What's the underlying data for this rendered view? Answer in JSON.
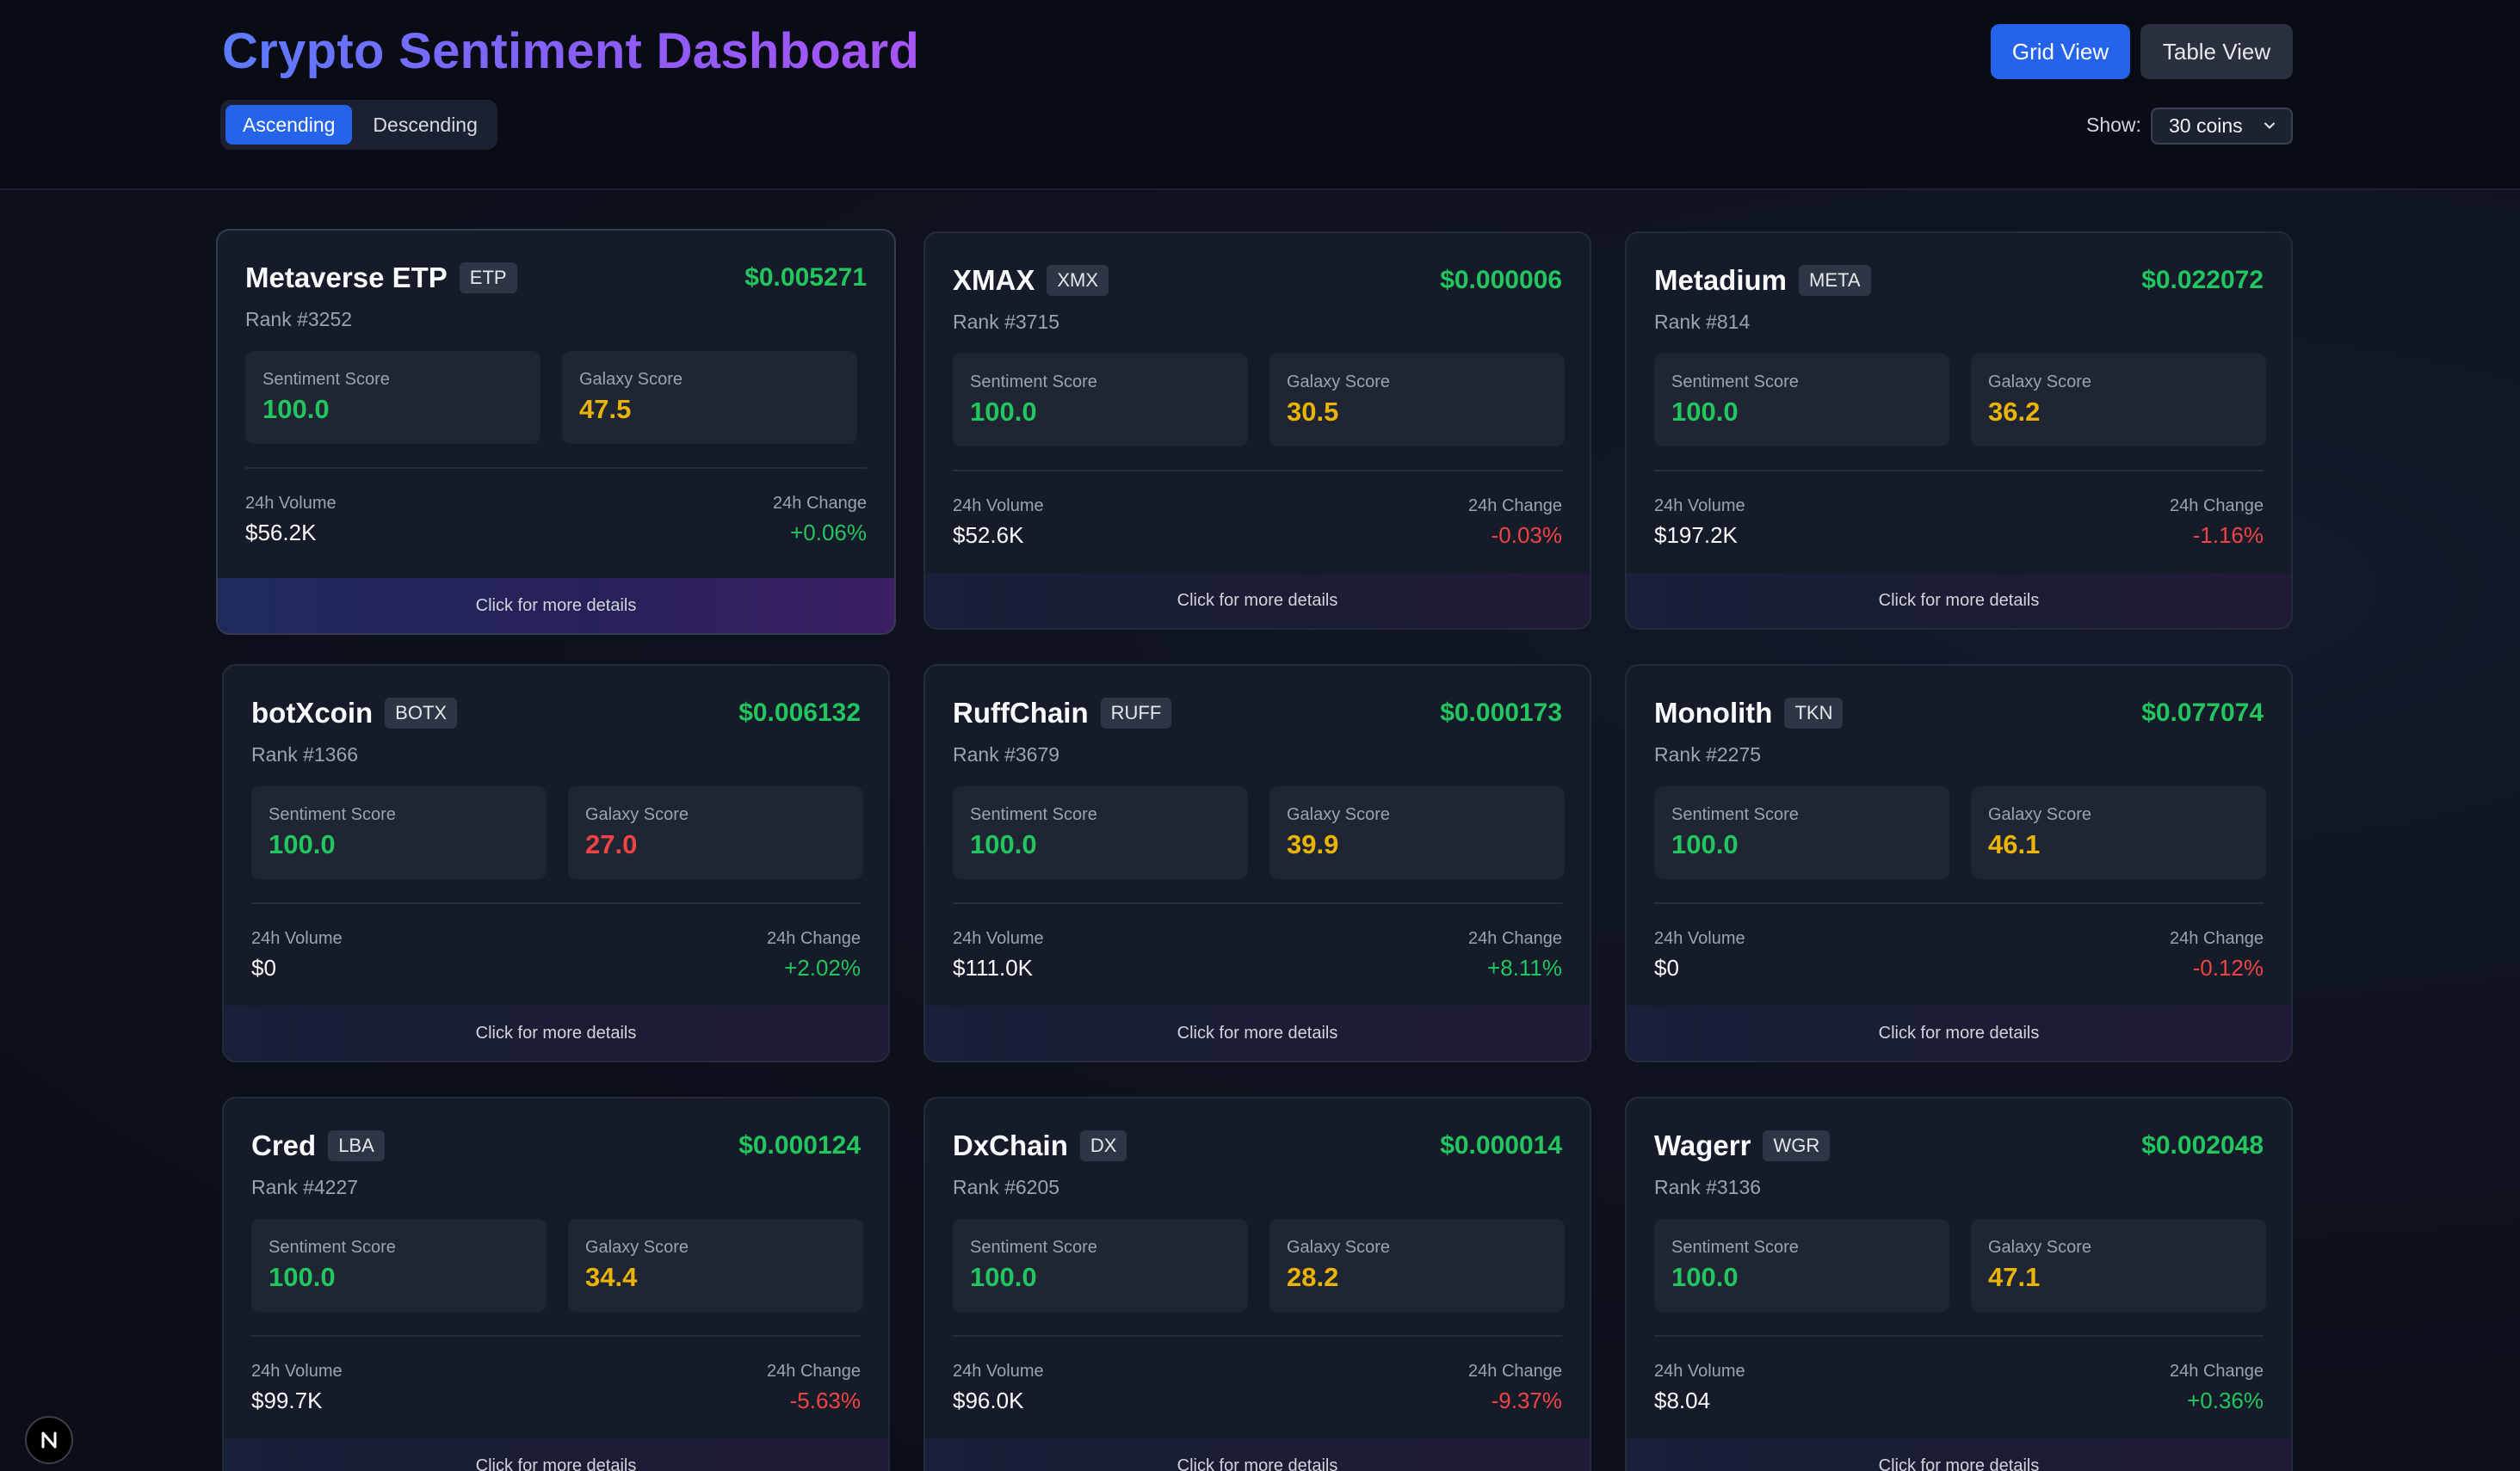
{
  "header": {
    "title": "Crypto Sentiment Dashboard",
    "sort": {
      "ascending": "Ascending",
      "descending": "Descending"
    },
    "views": {
      "grid": "Grid View",
      "table": "Table View"
    },
    "show_label": "Show:",
    "show_value": "30 coins"
  },
  "labels": {
    "sentiment": "Sentiment Score",
    "galaxy": "Galaxy Score",
    "volume": "24h Volume",
    "change": "24h Change",
    "details": "Click for more details"
  },
  "colors": {
    "accent": "#2563eb",
    "positive": "#22c55e",
    "negative": "#ef4444",
    "medium": "#eab308"
  },
  "coins": [
    {
      "name": "Metaverse ETP",
      "symbol": "ETP",
      "price": "$0.005271",
      "rank": "Rank #3252",
      "sentiment": "100.0",
      "galaxy": "47.5",
      "volume": "$56.2K",
      "change": "+0.06%"
    },
    {
      "name": "XMAX",
      "symbol": "XMX",
      "price": "$0.000006",
      "rank": "Rank #3715",
      "sentiment": "100.0",
      "galaxy": "30.5",
      "volume": "$52.6K",
      "change": "-0.03%"
    },
    {
      "name": "Metadium",
      "symbol": "META",
      "price": "$0.022072",
      "rank": "Rank #814",
      "sentiment": "100.0",
      "galaxy": "36.2",
      "volume": "$197.2K",
      "change": "-1.16%"
    },
    {
      "name": "botXcoin",
      "symbol": "BOTX",
      "price": "$0.006132",
      "rank": "Rank #1366",
      "sentiment": "100.0",
      "galaxy": "27.0",
      "volume": "$0",
      "change": "+2.02%"
    },
    {
      "name": "RuffChain",
      "symbol": "RUFF",
      "price": "$0.000173",
      "rank": "Rank #3679",
      "sentiment": "100.0",
      "galaxy": "39.9",
      "volume": "$111.0K",
      "change": "+8.11%"
    },
    {
      "name": "Monolith",
      "symbol": "TKN",
      "price": "$0.077074",
      "rank": "Rank #2275",
      "sentiment": "100.0",
      "galaxy": "46.1",
      "volume": "$0",
      "change": "-0.12%"
    },
    {
      "name": "Cred",
      "symbol": "LBA",
      "price": "$0.000124",
      "rank": "Rank #4227",
      "sentiment": "100.0",
      "galaxy": "34.4",
      "volume": "$99.7K",
      "change": "-5.63%"
    },
    {
      "name": "DxChain",
      "symbol": "DX",
      "price": "$0.000014",
      "rank": "Rank #6205",
      "sentiment": "100.0",
      "galaxy": "28.2",
      "volume": "$96.0K",
      "change": "-9.37%"
    },
    {
      "name": "Wagerr",
      "symbol": "WGR",
      "price": "$0.002048",
      "rank": "Rank #3136",
      "sentiment": "100.0",
      "galaxy": "47.1",
      "volume": "$8.04",
      "change": "+0.36%"
    }
  ],
  "badge": {
    "letter": "N"
  }
}
